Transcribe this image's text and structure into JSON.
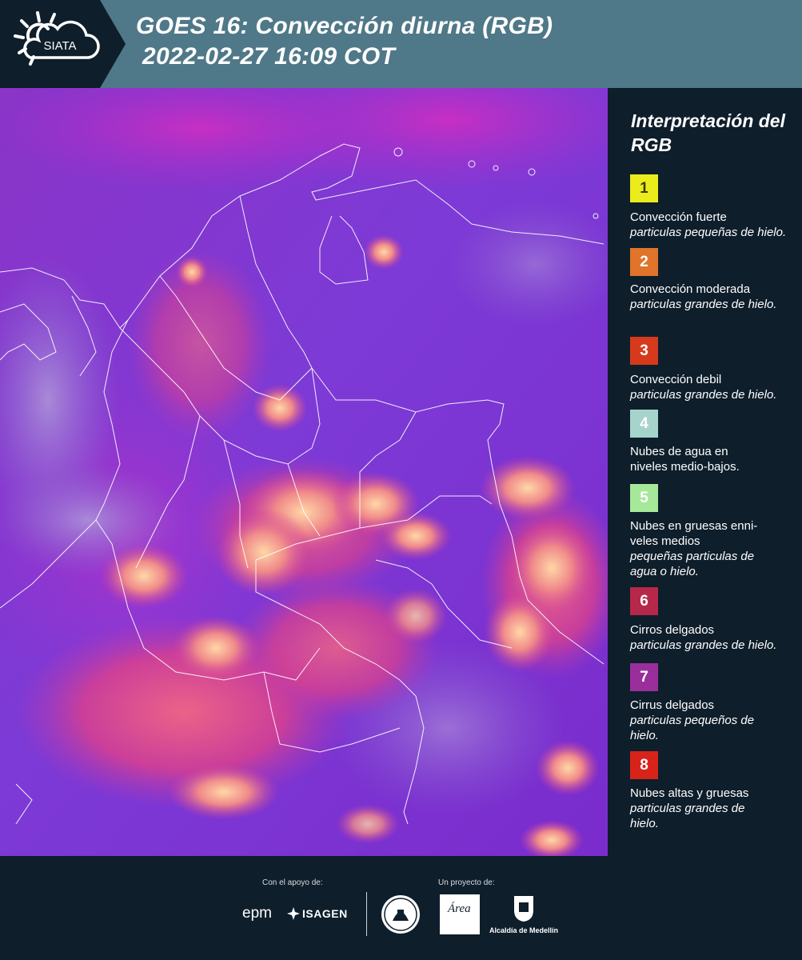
{
  "header": {
    "logo_text": "SIATA",
    "title_line1": "GOES 16: Convección diurna (RGB)",
    "title_line2": "2022-02-27 16:09 COT",
    "background_color": "#4f7888"
  },
  "map": {
    "icon": "satellite-rgb-convection-map"
  },
  "legend": {
    "title": "Interpretación del RGB",
    "items": [
      {
        "number": "1",
        "color": "#ecec1c",
        "number_color": "#3a3a10",
        "description": "Convección fuerte",
        "subtitle": "particulas pequeñas de hielo."
      },
      {
        "number": "2",
        "color": "#e0742a",
        "number_color": "#ffffff",
        "description": "Convección moderada",
        "subtitle": "particulas grandes de hielo."
      },
      {
        "number": "3",
        "color": "#d63a1c",
        "number_color": "#ffffff",
        "description": "Convección debil",
        "subtitle": "particulas grandes de hielo."
      },
      {
        "number": "4",
        "color": "#a6d4cc",
        "number_color": "#ffffff",
        "description": "Nubes de agua en niveles medio-bajos.",
        "subtitle": ""
      },
      {
        "number": "5",
        "color": "#a6e89a",
        "number_color": "#ffffff",
        "description": "Nubes en gruesas enni-veles medios",
        "subtitle": "pequeñas particulas de agua o hielo."
      },
      {
        "number": "6",
        "color": "#b5284a",
        "number_color": "#ffffff",
        "description": "Cirros delgados",
        "subtitle": "particulas grandes de hielo."
      },
      {
        "number": "7",
        "color": "#9a2f9c",
        "number_color": "#ffffff",
        "description": "Cirrus delgados",
        "subtitle": "particulas pequeños de hielo."
      },
      {
        "number": "8",
        "color": "#d8231a",
        "number_color": "#ffffff",
        "description": "Nubes altas y gruesas",
        "subtitle": "particulas grandes de hielo."
      }
    ]
  },
  "footer": {
    "support_caption": "Con el apoyo de:",
    "project_caption": "Un proyecto de:",
    "sponsor_epm": "epm",
    "sponsor_isagen": "ISAGEN",
    "partner_area_metropolitana": "Área",
    "partner_alcaldia": "Alcaldía de Medellín"
  }
}
